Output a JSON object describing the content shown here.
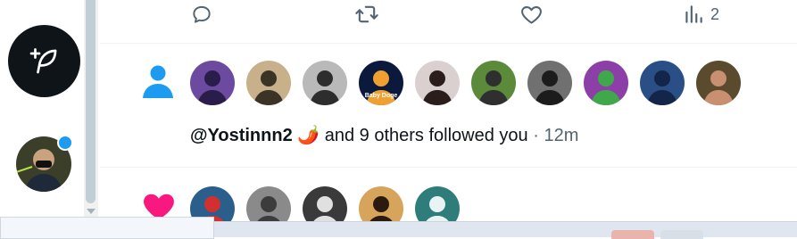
{
  "action_bar": {
    "views_count": "2"
  },
  "notifications": [
    {
      "type": "follow",
      "username": "@Yostinnn2",
      "emoji": "🌶️",
      "others_text": "and 9 others followed you",
      "separator": "·",
      "time": "12m",
      "avatars": [
        {
          "colors": [
            "#6b4aa0",
            "#2a1d4a"
          ]
        },
        {
          "colors": [
            "#c7b08a",
            "#3a3326"
          ]
        },
        {
          "colors": [
            "#b9b9b9",
            "#2d2d2d"
          ]
        },
        {
          "colors": [
            "#0b1a3c",
            "#f0a030"
          ],
          "label": "Baby Doge"
        },
        {
          "colors": [
            "#d9d0cf",
            "#2b1d1c"
          ]
        },
        {
          "colors": [
            "#5a8a3a",
            "#2f2f2f"
          ]
        },
        {
          "colors": [
            "#707070",
            "#1c1c1c"
          ]
        },
        {
          "colors": [
            "#8d3fa8",
            "#3fa84a"
          ]
        },
        {
          "colors": [
            "#2a4f86",
            "#13264a"
          ]
        },
        {
          "colors": [
            "#5a4a2e",
            "#c89070"
          ]
        }
      ]
    },
    {
      "type": "like",
      "avatars": [
        {
          "colors": [
            "#2a5f8c",
            "#d23030"
          ]
        },
        {
          "colors": [
            "#8a8a8a",
            "#3c3c3c"
          ]
        },
        {
          "colors": [
            "#3a3a3a",
            "#e0e0e0"
          ]
        },
        {
          "colors": [
            "#d6a45a",
            "#2b1a0e"
          ]
        },
        {
          "colors": [
            "#2e7d7a",
            "#e8f4f3"
          ]
        }
      ]
    }
  ],
  "colors": {
    "accent": "#1d9bf0",
    "like": "#f91880",
    "text": "#0f1419",
    "muted": "#536471"
  },
  "icons": {
    "compose": "feather-plus-icon",
    "reply": "reply-icon",
    "retweet": "retweet-icon",
    "like": "heart-icon",
    "views": "views-bar-chart-icon",
    "follow": "person-icon"
  }
}
